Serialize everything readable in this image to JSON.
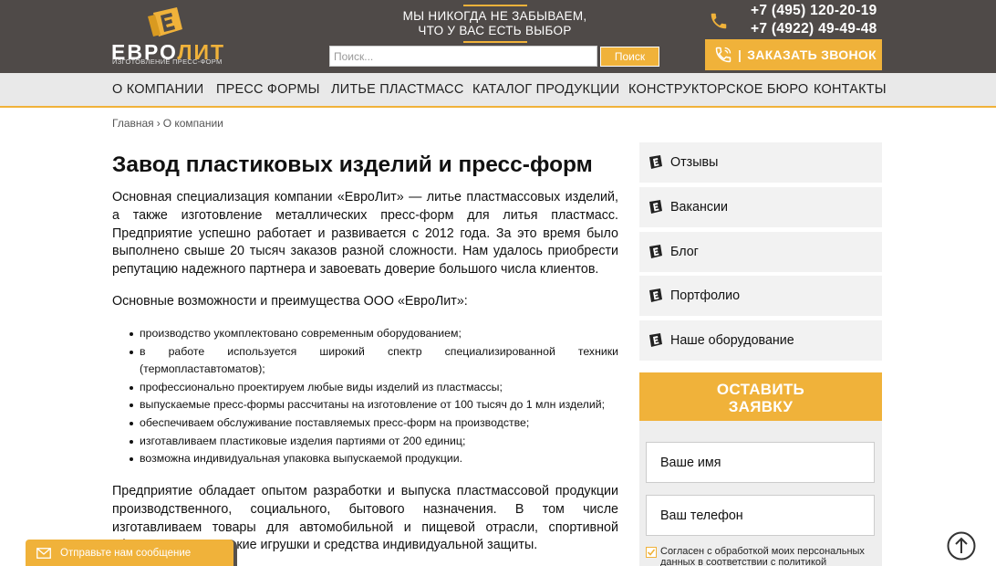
{
  "header": {
    "logo_text_a": "ЕВРО",
    "logo_text_b": "ЛИТ",
    "logo_sub": "ИЗГОТОВЛЕНИЕ ПРЕСС-ФОРМ",
    "slogan_line1": "МЫ НИКОГДА НЕ ЗАБЫВАЕМ,",
    "slogan_line2": "ЧТО У ВАС ЕСТЬ ВЫБОР",
    "phone1": "+7 (495) 120-20-19",
    "phone2": "+7 (4922) 49-49-48",
    "callback_sep": "|",
    "callback_label": "ЗАКАЗАТЬ ЗВОНОК",
    "search_placeholder": "Поиск...",
    "search_button": "Поиск"
  },
  "nav": [
    "О КОМПАНИИ",
    "ПРЕСС ФОРМЫ",
    "ЛИТЬЕ ПЛАСТМАСС",
    "КАТАЛОГ ПРОДУКЦИИ",
    "КОНСТРУКТОРСКОЕ БЮРО",
    "КОНТАКТЫ"
  ],
  "breadcrumb": {
    "home": "Главная",
    "sep": "›",
    "current": "О компании"
  },
  "main": {
    "title": "Завод пластиковых изделий и пресс-форм",
    "p1": "Основная специализация компании «ЕвроЛит» — литье пластмассовых изделий, а также изготовление металлических пресс-форм для литья пластмасс. Предприятие успешно работает и развивается с 2012 года. За это время было выполнено свыше 20 тысяч заказов разной сложности. Нам удалось приобрести репутацию надежного партнера и завоевать доверие большого числа клиентов.",
    "p2": "Основные возможности и преимущества ООО «ЕвроЛит»:",
    "features": [
      "производство укомплектовано современным оборудованием;",
      "в работе используется широкий спектр специализированной техники (термопластавтоматов);",
      "профессионально проектируем любые виды изделий из пластмассы;",
      "выпускаемые пресс-формы рассчитаны на изготовление от 100 тысяч до 1 млн изделий;",
      "обеспечиваем обслуживание поставляемых пресс-форм на производстве;",
      "изготавливаем пластиковые изделия партиями от 200 единиц;",
      "возможна индивидуальная упаковка выпускаемой продукции."
    ],
    "p3": "Предприятие обладает опытом разработки и выпуска пластмассовой продукции производственного, социального, бытового назначения. В том числе изготавливаем товары для автомобильной и пищевой отрасли, спортивной сферы, а также детские игрушки и средства индивидуальной защиты."
  },
  "sidebar": {
    "items": [
      "Отзывы",
      "Вакансии",
      "Блог",
      "Портфолио",
      "Наше оборудование"
    ],
    "order_line1": "ОСТАВИТЬ",
    "order_line2": "ЗАЯВКУ",
    "name_placeholder": "Ваше имя",
    "phone_placeholder": "Ваш телефон",
    "consent": "Согласен с обработкой моих персональных данных в соответствии с политикой"
  },
  "floating": {
    "message": "Отправьте нам сообщение"
  },
  "colors": {
    "accent": "#f0b23a",
    "header_bg": "#4f4a48",
    "nav_bg": "#e9e9e9"
  }
}
